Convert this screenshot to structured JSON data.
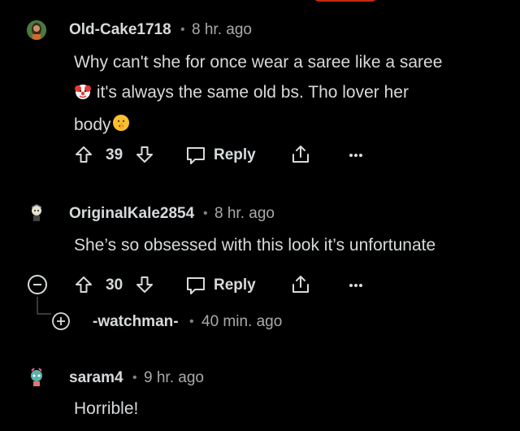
{
  "comments": [
    {
      "username": "Old-Cake1718",
      "time": "8 hr. ago",
      "text_line1": "Why can't she for once wear a saree like a saree",
      "text_line2": " it's always the same old bs. Tho lover her",
      "text_line3": "body",
      "votes": "39",
      "reply_label": "Reply"
    },
    {
      "username": "OriginalKale2854",
      "time": "8 hr. ago",
      "text": "She’s so obsessed with this look it’s unfortunate",
      "votes": "30",
      "reply_label": "Reply"
    },
    {
      "username": "-watchman-",
      "time": "40 min. ago",
      "collapsed": true
    },
    {
      "username": "saram4",
      "time": "9 hr. ago",
      "text": "Horrible!"
    }
  ],
  "separator": "•",
  "colors": {
    "background": "#000000",
    "text": "#d7dadc",
    "muted": "#818384",
    "accent": "#c42b10"
  }
}
